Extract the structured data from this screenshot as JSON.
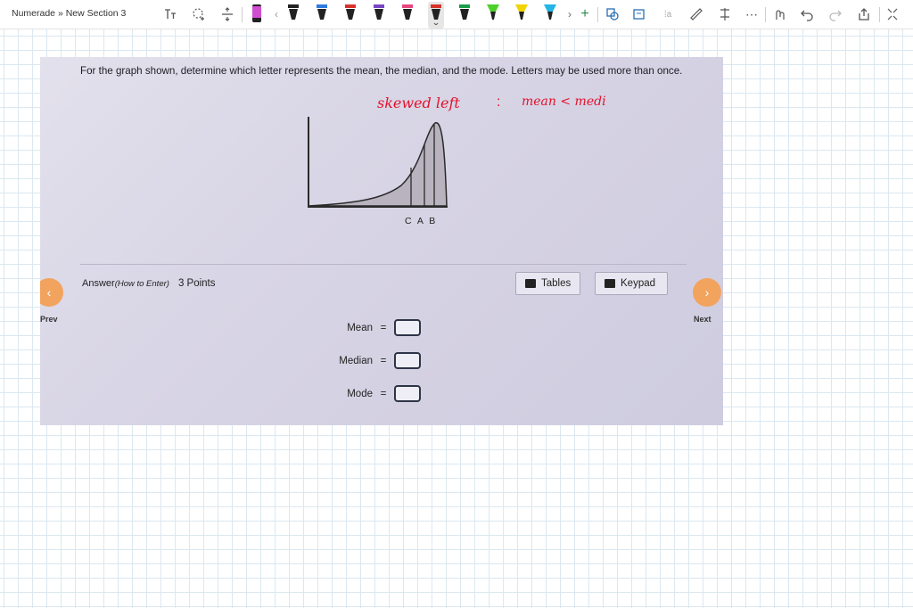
{
  "toolbar": {
    "breadcrumb": "Numerade » New Section 3",
    "pen_colors": [
      "#f4d51f",
      "#222222",
      "#2d7ce0",
      "#d8332b",
      "#7a44c6",
      "#e8467e",
      "#222222",
      "#1a9e4a",
      "#4cd12b",
      "#f2d400",
      "#2d7ce0",
      "#23b5e6"
    ],
    "icons": [
      "text-mode-icon",
      "lasso-icon",
      "insert-space-icon",
      "ruler-icon",
      "undo-icon",
      "redo-icon",
      "share-icon",
      "expand-icon"
    ]
  },
  "question": {
    "prompt": "For the graph shown, determine which letter represents the mean, the median, and the mode. Letters may be used more than once.",
    "letters": "C A B"
  },
  "annotation": {
    "skewed": "skewed left",
    "colon": ":",
    "relation": "mean < medi"
  },
  "answer": {
    "label": "Answer",
    "how_to": "(How to Enter)",
    "points": "3 Points",
    "tables_label": "Tables",
    "keypad_label": "Keypad",
    "prev_label": "Prev",
    "next_label": "Next",
    "fields": [
      {
        "label": "Mean",
        "equals": "=",
        "value": ""
      },
      {
        "label": "Median",
        "equals": "=",
        "value": ""
      },
      {
        "label": "Mode",
        "equals": "=",
        "value": ""
      }
    ]
  },
  "colors": {
    "annotation_red": "#e3122c",
    "nav_orange": "#f2a35e",
    "grid": "#dbe8f1"
  }
}
